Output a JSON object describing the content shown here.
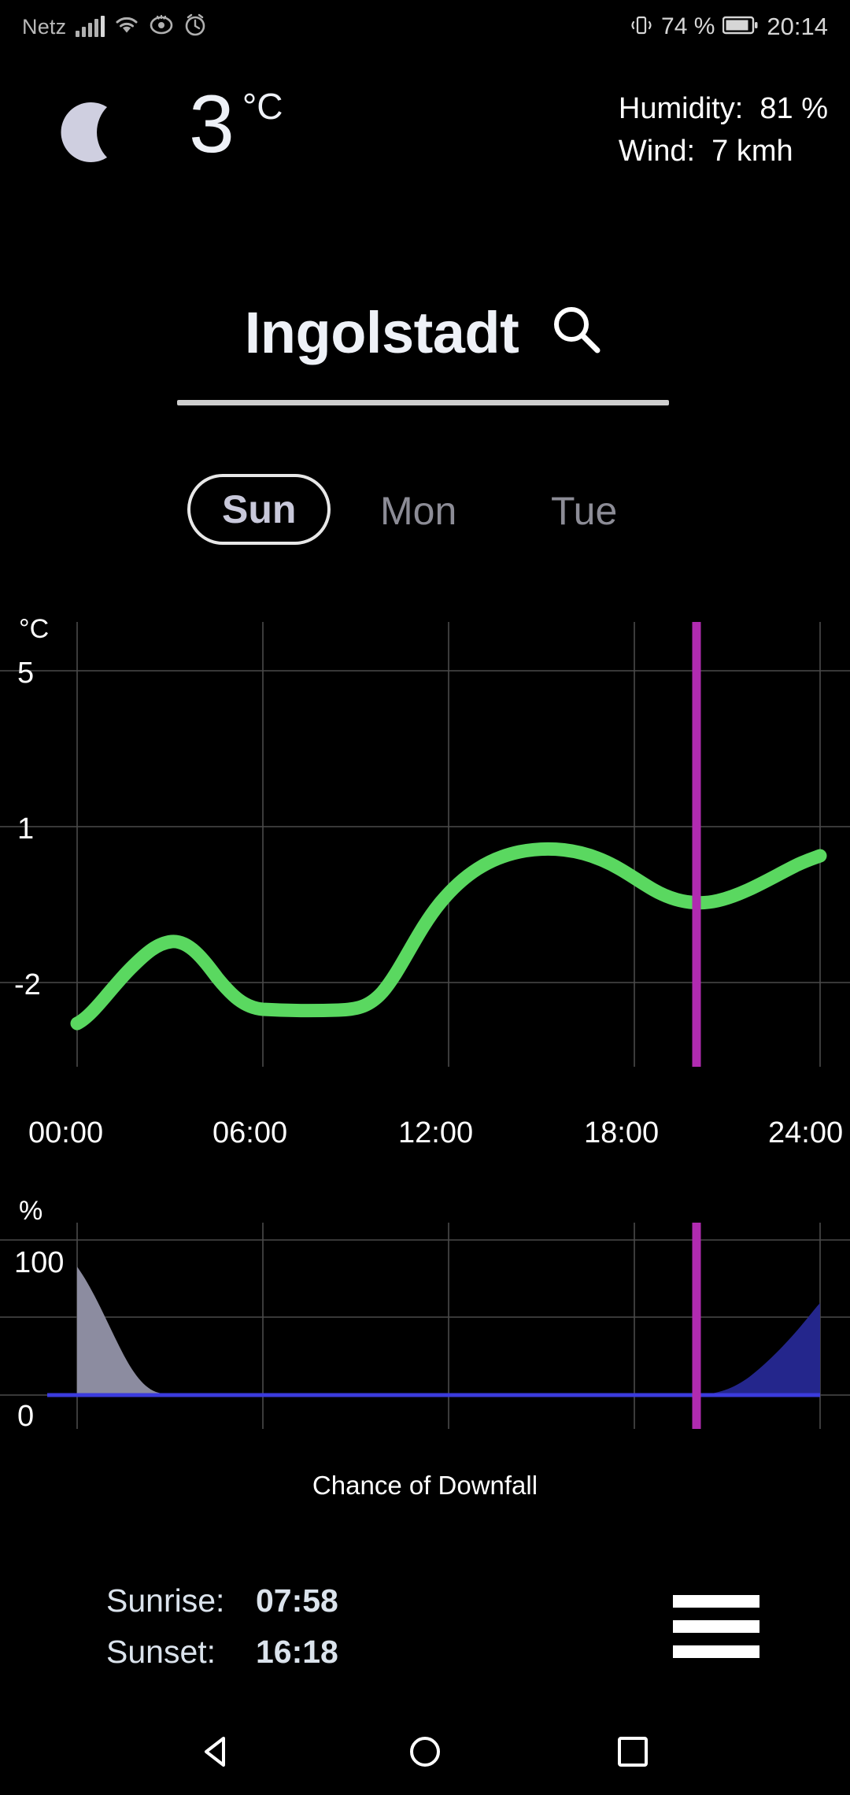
{
  "statusbar": {
    "carrier": "Netz",
    "battery_pct": "74 %",
    "time": "20:14",
    "icons": [
      "signal-icon",
      "wifi-icon",
      "eye-icon",
      "alarm-icon",
      "vibrate-icon",
      "battery-icon"
    ]
  },
  "header": {
    "condition_icon": "moon-icon",
    "temperature": "3",
    "temperature_unit": "°C",
    "humidity": "Humidity:  81 %",
    "wind": "Wind:  7 kmh"
  },
  "city": {
    "name": "Ingolstadt",
    "search_icon": "search-icon"
  },
  "days": [
    {
      "label": "Sun",
      "selected": true
    },
    {
      "label": "Mon",
      "selected": false
    },
    {
      "label": "Tue",
      "selected": false
    }
  ],
  "footer": {
    "sunrise_label": "Sunrise:",
    "sunrise_value": "07:58",
    "sunset_label": "Sunset:",
    "sunset_value": "16:18",
    "menu_icon": "hamburger-menu-icon"
  },
  "navbar": {
    "back_icon": "back-triangle-icon",
    "home_icon": "home-circle-icon",
    "recents_icon": "recents-square-icon"
  },
  "colors": {
    "background": "#000000",
    "temperature_line": "#5ad860",
    "current_time_marker": "#b02bb0",
    "precip_past_fill": "#8c8ca0",
    "precip_future_fill": "#24268c",
    "precip_baseline": "#3b3bdd",
    "grid": "#4a4a4a",
    "moon": "#cfcfe0",
    "selected_day_text": "#c8c8da"
  },
  "chart_data": [
    {
      "type": "line",
      "title": "",
      "ylabel": "°C",
      "xlabel": "",
      "y_ticks": [
        "5",
        "1",
        "-2"
      ],
      "y_tick_values": [
        5,
        1,
        -2
      ],
      "ylim": [
        -3.6,
        6.8
      ],
      "x_ticks": [
        "00:00",
        "06:00",
        "12:00",
        "18:00",
        "24:00"
      ],
      "x_tick_values": [
        0,
        6,
        12,
        18,
        24
      ],
      "xlim": [
        0,
        24
      ],
      "grid": true,
      "legend": null,
      "series": [
        {
          "name": "Temperature",
          "color": "#5ad860",
          "x": [
            0,
            1,
            2,
            3,
            4,
            5,
            6,
            7,
            8,
            9,
            10,
            11,
            12,
            13,
            14,
            15,
            16,
            17,
            18,
            19,
            20,
            21,
            22,
            23,
            24
          ],
          "values": [
            -1.8,
            -1.3,
            -0.7,
            -0.25,
            -0.1,
            -0.35,
            -0.85,
            -1.25,
            -1.45,
            -1.5,
            -1.5,
            -1.45,
            -1.2,
            -0.6,
            0.3,
            1.1,
            1.6,
            1.85,
            1.85,
            1.6,
            1.25,
            1.05,
            1.05,
            1.3,
            1.7
          ]
        }
      ],
      "annotations": [
        {
          "type": "vline",
          "label": "current time",
          "x": 20.2,
          "color": "#b02bb0"
        }
      ]
    },
    {
      "type": "area",
      "title": "Chance of Downfall",
      "ylabel": "%",
      "xlabel": "",
      "y_ticks": [
        "100",
        "0"
      ],
      "y_tick_values": [
        100,
        0
      ],
      "ylim": [
        0,
        118
      ],
      "x_ticks": [],
      "x_tick_values": [
        0,
        6,
        12,
        18,
        24
      ],
      "xlim": [
        0,
        24
      ],
      "grid": true,
      "legend": null,
      "series": [
        {
          "name": "Past precipitation chance",
          "color": "#8c8ca0",
          "x": [
            0,
            0.5,
            1,
            1.5,
            2,
            2.5,
            3,
            3.5,
            4,
            4.5,
            5,
            6,
            24
          ],
          "values": [
            100,
            86,
            70,
            56,
            42,
            30,
            20,
            12,
            6,
            3,
            1,
            0,
            0
          ]
        },
        {
          "name": "Forecast precipitation chance",
          "color": "#24268c",
          "x": [
            20.2,
            20.6,
            21,
            21.5,
            22,
            22.5,
            23,
            23.5,
            24
          ],
          "values": [
            0,
            1,
            4,
            10,
            19,
            31,
            44,
            56,
            66
          ]
        }
      ],
      "annotations": [
        {
          "type": "vline",
          "label": "current time",
          "x": 20.2,
          "color": "#b02bb0"
        },
        {
          "type": "hline",
          "label": "baseline",
          "y": 0,
          "color": "#3b3bdd"
        }
      ]
    }
  ]
}
